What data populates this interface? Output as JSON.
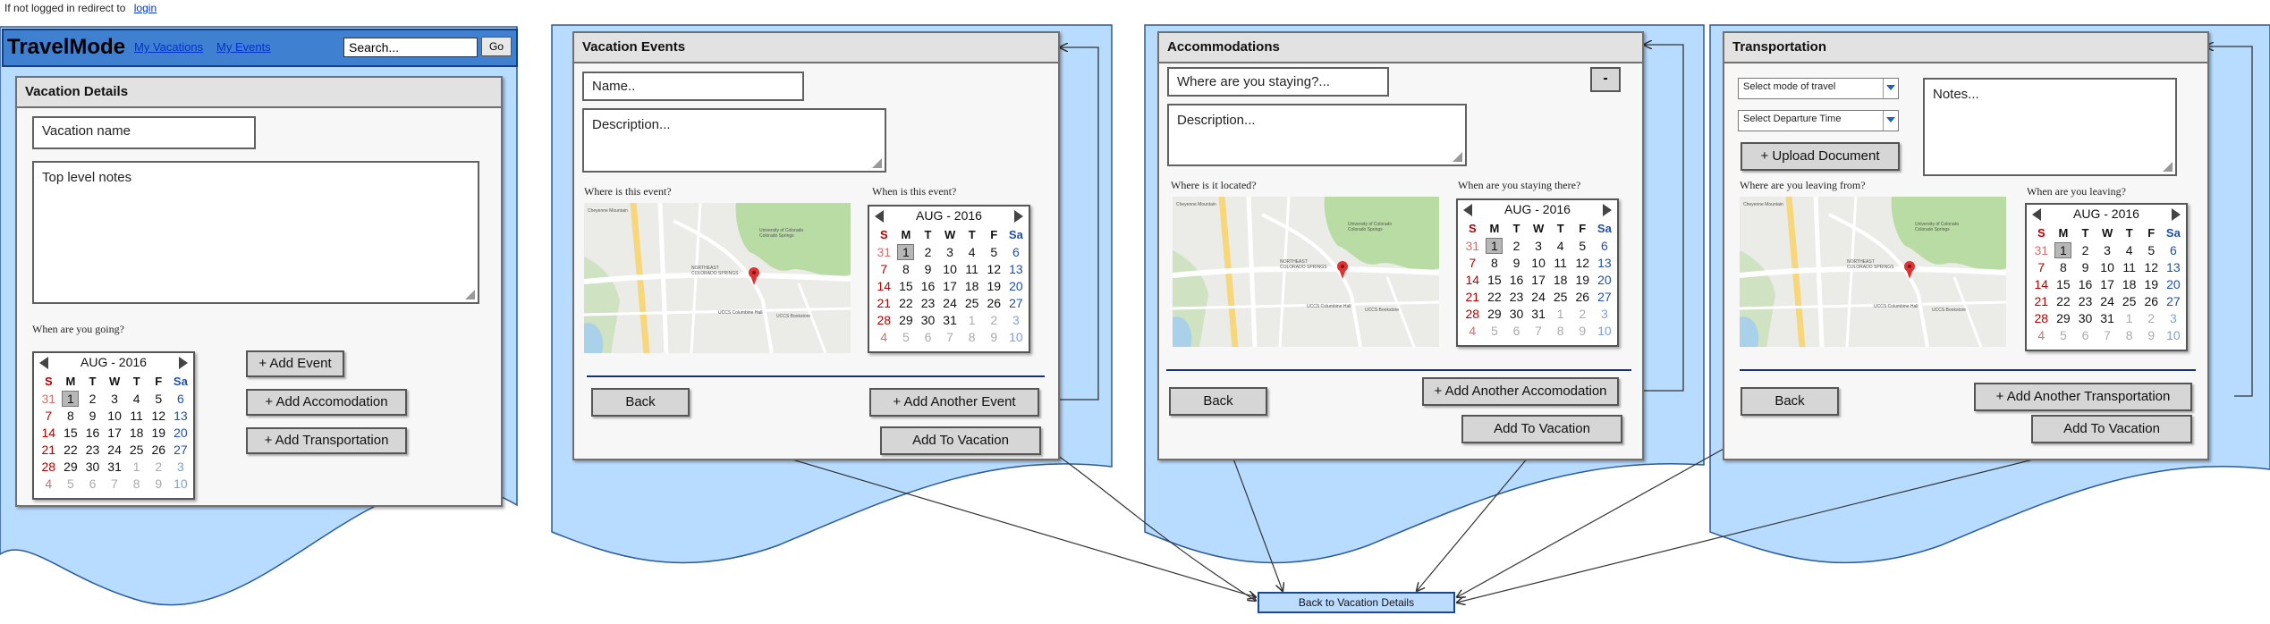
{
  "notice": {
    "text": "If not logged in redirect to",
    "link": "login"
  },
  "topbar": {
    "logo": "TravelMode",
    "nav": [
      "My Vacations",
      "My Events"
    ],
    "search_placeholder": "Search...",
    "go_label": "Go"
  },
  "vacation_details": {
    "title": "Vacation Details",
    "name_placeholder": "Vacation name",
    "notes_placeholder": "Top level notes",
    "when_label": "When are you going?",
    "buttons": [
      "+ Add Event",
      "+ Add Accomodation",
      "+ Add Transportation"
    ]
  },
  "vacation_events": {
    "title": "Vacation Events",
    "name_placeholder": "Name..",
    "description_placeholder": "Description...",
    "where_label": "Where is this event?",
    "when_label": "When is this event?",
    "back_label": "Back",
    "add_another_label": "+ Add Another Event",
    "add_to_vacation_label": "Add To Vacation"
  },
  "accommodations": {
    "title": "Accommodations",
    "where_placeholder": "Where are you staying?...",
    "minus_label": "-",
    "description_placeholder": "Description...",
    "where_label": "Where is it located?",
    "when_label": "When are you staying there?",
    "back_label": "Back",
    "add_another_label": "+ Add Another Accomodation",
    "add_to_vacation_label": "Add To Vacation"
  },
  "transportation": {
    "title": "Transportation",
    "mode_select": "Select mode of travel",
    "departure_select": "Select Departure Time",
    "upload_label": "+ Upload Document",
    "notes_placeholder": "Notes...",
    "where_label": "Where are you leaving from?",
    "when_label": "When are you leaving?",
    "back_label": "Back",
    "add_another_label": "+ Add Another Transportation",
    "add_to_vacation_label": "Add To Vacation"
  },
  "back_to_details": "Back to Vacation Details",
  "calendar": {
    "month_label": "AUG - 2016",
    "day_headers": [
      "S",
      "M",
      "T",
      "W",
      "T",
      "F",
      "Sa"
    ],
    "weeks": [
      [
        "31",
        "1",
        "2",
        "3",
        "4",
        "5",
        "6"
      ],
      [
        "7",
        "8",
        "9",
        "10",
        "11",
        "12",
        "13"
      ],
      [
        "14",
        "15",
        "16",
        "17",
        "18",
        "19",
        "20"
      ],
      [
        "21",
        "22",
        "23",
        "24",
        "25",
        "26",
        "27"
      ],
      [
        "28",
        "29",
        "30",
        "31",
        "1",
        "2",
        "3"
      ],
      [
        "4",
        "5",
        "6",
        "7",
        "8",
        "9",
        "10"
      ]
    ],
    "selected": "1"
  },
  "map": {
    "labels": [
      "Cheyenne Mountain",
      "University of Colorado Colorado Springs",
      "NORTHEAST COLORADO SPRINGS",
      "UCCS Columbine Hall",
      "UCCS Bookstore"
    ]
  },
  "colors": {
    "sheet_fill": "#b8dcff",
    "sheet_border": "#2a5a9a",
    "topbar_fill": "#4080d0",
    "panel_fill": "#f7f7f7",
    "button_fill": "#d6d6d6"
  }
}
